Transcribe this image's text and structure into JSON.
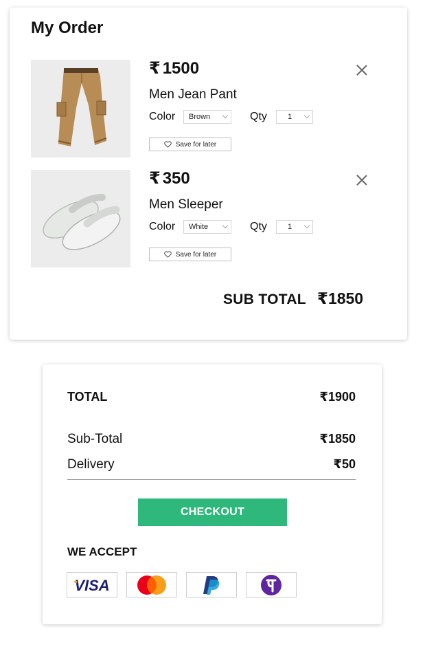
{
  "order": {
    "title": "My Order",
    "currency": "₹",
    "items": [
      {
        "price": "1500",
        "name": "Men Jean Pant",
        "color_label": "Color",
        "color_value": "Brown",
        "qty_label": "Qty",
        "qty_value": "1",
        "save_label": "Save for later",
        "icon": "cargo-pants-image"
      },
      {
        "price": "350",
        "name": "Men Sleeper",
        "color_label": "Color",
        "color_value": "White",
        "qty_label": "Qty",
        "qty_value": "1",
        "save_label": "Save for later",
        "icon": "slippers-image"
      }
    ],
    "subtotal_label": "SUB TOTAL",
    "subtotal_value": "1850"
  },
  "summary": {
    "total_label": "TOTAL",
    "total_value": "1900",
    "subtotal_label": "Sub-Total",
    "subtotal_value": "1850",
    "delivery_label": "Delivery",
    "delivery_value": "50",
    "checkout_label": "CHECKOUT",
    "accept_title": "WE ACCEPT",
    "payment_methods": [
      "VISA",
      "mastercard",
      "PayPal",
      "PhonePe"
    ]
  },
  "colors": {
    "checkout": "#2fb87c",
    "visa": "#1a1f71",
    "mastercard_red": "#eb001b",
    "mastercard_orange": "#f79e1b",
    "paypal_dark": "#253b80",
    "paypal_light": "#179bd7",
    "phonepe": "#5f259f"
  }
}
